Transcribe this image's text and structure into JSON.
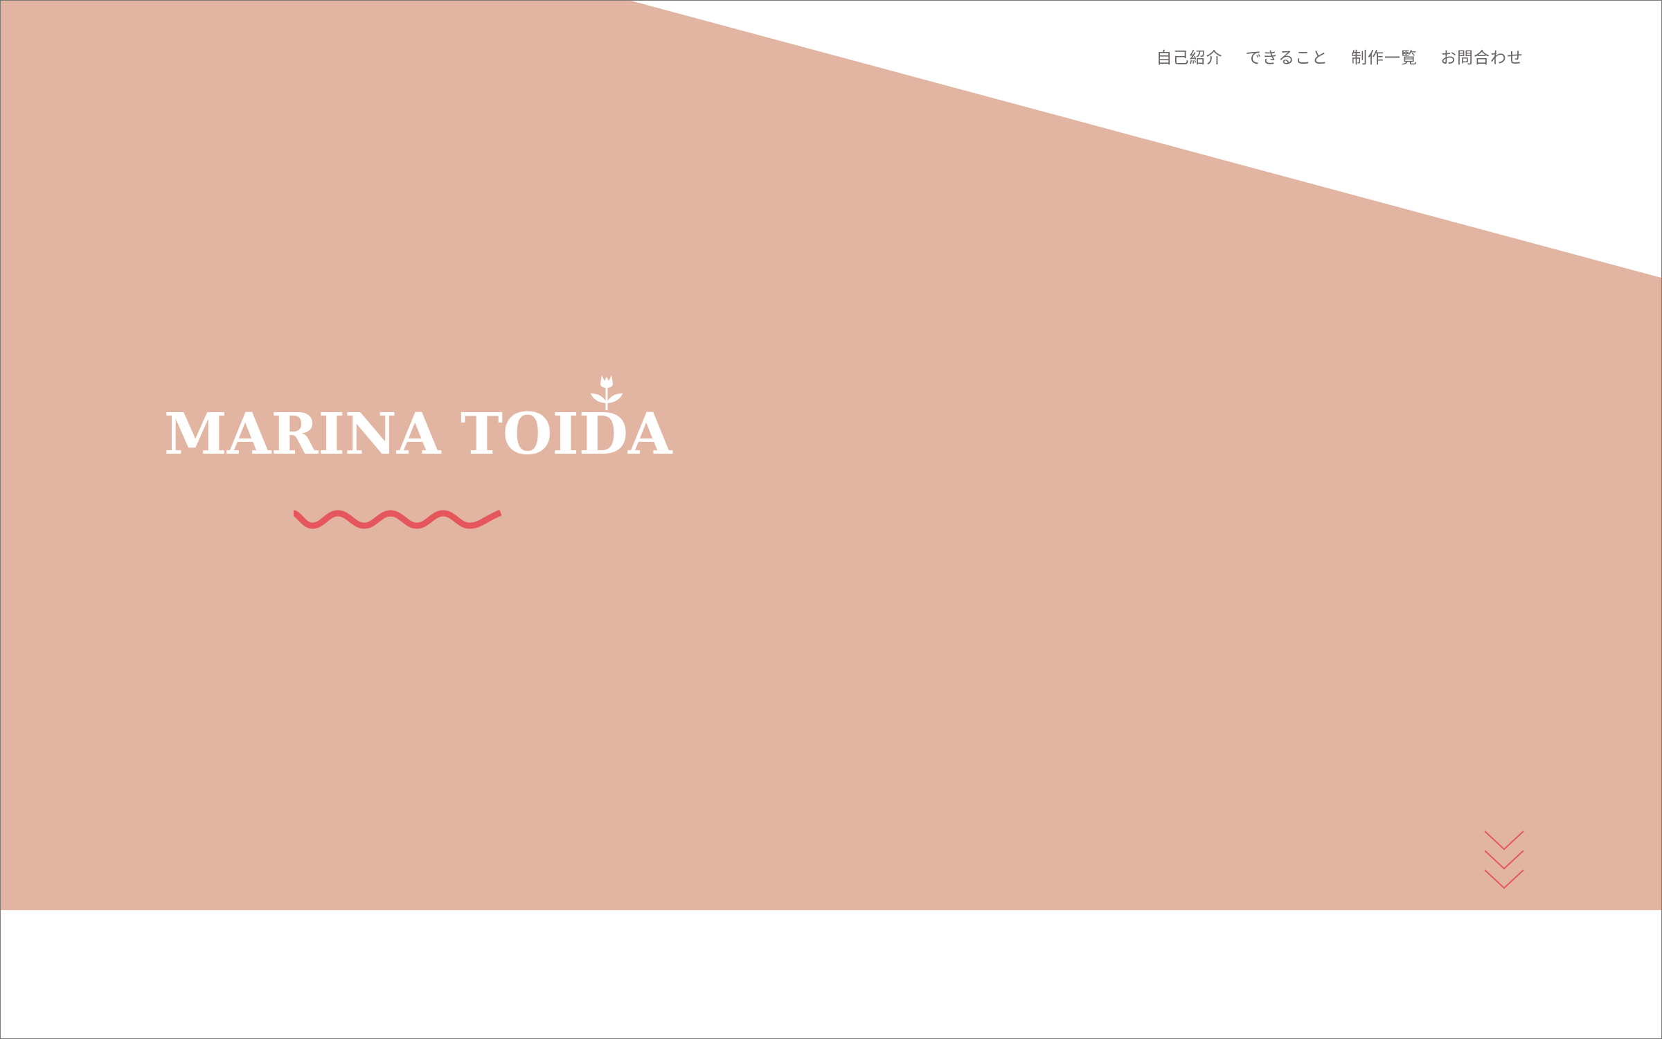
{
  "colors": {
    "hero_background": "#e2b5a2",
    "accent": "#e5575c",
    "nav_text": "#6a6464",
    "logo_text": "#ffffff",
    "page_background": "#ffffff"
  },
  "nav": {
    "items": [
      {
        "label": "自己紹介"
      },
      {
        "label": "できること"
      },
      {
        "label": "制作一覧"
      },
      {
        "label": "お問合わせ"
      }
    ]
  },
  "hero": {
    "logo": {
      "text": "MARINA TOIDA",
      "icon": "tulip-icon"
    },
    "decoration": "wave-icon",
    "scroll_indicator": "chevron-down-icon"
  }
}
